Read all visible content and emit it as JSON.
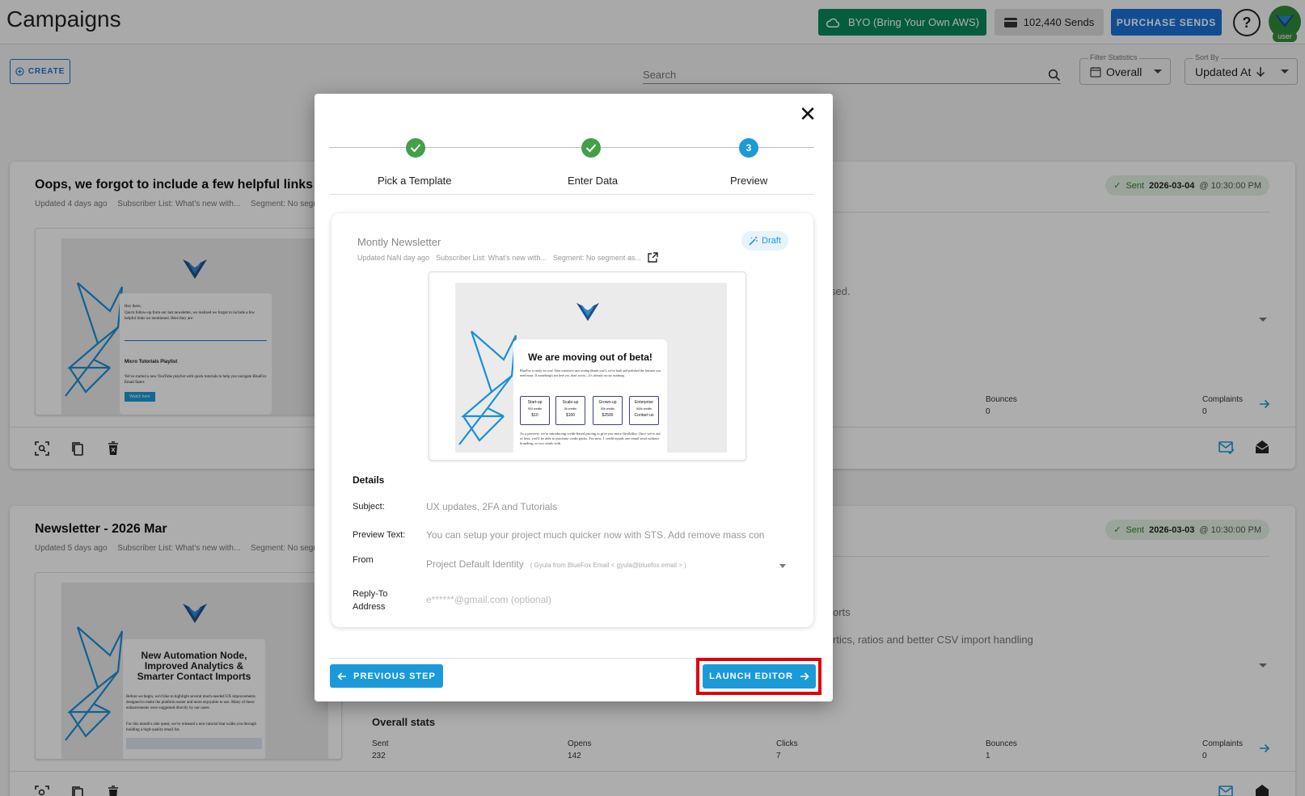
{
  "header": {
    "title": "Campaigns",
    "byo_label": "BYO (Bring Your Own AWS)",
    "sends_label": "102,440 Sends",
    "purchase_label": "PURCHASE SENDS",
    "help_label": "?",
    "avatar_badge": "user"
  },
  "toolbar": {
    "create_label": "CREATE",
    "search_placeholder": "Search",
    "filter": {
      "label": "Filter Statistics",
      "value": "Overall"
    },
    "sort": {
      "label": "Sort By",
      "value": "Updated At"
    }
  },
  "campaigns": [
    {
      "title": "Oops, we forgot to include a few helpful links",
      "updated": "Updated 4 days ago",
      "subscriber_list": "Subscriber List: What's new with...",
      "segment": "Segment: No segm",
      "status": "Sent",
      "date": "2026-03-04",
      "time": "@ 10:30:00 PM",
      "body_snippet": "sed.",
      "thumb_greeting": "Hey there,",
      "thumb_text": "Quick follow-up from our last newsletter, we realized we forgot to include a few helpful links we mentioned. Here they are:",
      "thumb_heading": "Micro Tutorials Playlist",
      "thumb_text2": "We've started a new YouTube playlist with quick tutorials to help you navigate BlueFox Email faster.",
      "thumb_button": "Watch here",
      "stats": {
        "bounces_label": "Bounces",
        "bounces": "0",
        "complaints_label": "Complaints",
        "complaints": "0"
      }
    },
    {
      "title": "Newsletter - 2026 Mar",
      "updated": "Updated 5 days ago",
      "subscriber_list": "Subscriber List: What's new with...",
      "segment": "Segment: No segm",
      "status": "Sent",
      "date": "2026-03-03",
      "time": "@ 10:30:00 PM",
      "body_snippet": "orts",
      "body_snippet2": "rtics, ratios and better CSV import handling",
      "thumb_heading": "New Automation Node, Improved Analytics & Smarter Contact Imports",
      "thumb_text": "Before we begin, we'd like to highlight several much-needed UX improvements designed to make the platform easier and more enjoyable to use. Many of these enhancements were suggested directly by our users.",
      "thumb_text2": "For this month's side quest, we've released a new tutorial that walks you through building a high-quality email list.",
      "overall_title": "Overall stats",
      "stats": {
        "sent_label": "Sent",
        "sent": "232",
        "opens_label": "Opens",
        "opens": "142",
        "clicks_label": "Clicks",
        "clicks": "7",
        "bounces_label": "Bounces",
        "bounces": "1",
        "complaints_label": "Complaints",
        "complaints": "0"
      }
    }
  ],
  "modal": {
    "close_label": "✕",
    "steps": [
      {
        "label": "Pick a Template",
        "state": "done"
      },
      {
        "label": "Enter Data",
        "state": "done"
      },
      {
        "label": "Preview",
        "state": "active",
        "number": "3"
      }
    ],
    "preview": {
      "title": "Montly Newsletter",
      "updated": "Updated NaN day ago",
      "subscriber_list": "Subscriber List: What's new with...",
      "segment": "Segment: No segment as...",
      "badge": "Draft",
      "email_headline": "We are moving out of beta!",
      "email_text": "BlueFox is ready for you! After extensive user testing (thank you!), we've built and polished the features you need most. If something's not here yet, don't worry—it's already on our roadmap.",
      "plans": [
        {
          "name": "Start-up",
          "sub": "500 credits",
          "price": "$10"
        },
        {
          "name": "Scale-up",
          "sub": "5k credits",
          "price": "$100"
        },
        {
          "name": "Grown-up",
          "sub": "50k credits",
          "price": "$2500"
        },
        {
          "name": "Enterprise",
          "sub": "500k credits",
          "price": "Contact us"
        }
      ],
      "email_text2": "As a preview, we're introducing credit-based pricing to give you more flexibility. Once we're out of beta, you'll be able to purchase credit packs. For now, 1 credit equals one email send without branding, or two sends with"
    },
    "details": {
      "title": "Details",
      "subject_label": "Subject:",
      "subject_value": "UX updates, 2FA and Tutorials",
      "preview_label": "Preview Text:",
      "preview_value": "You can setup your project much quicker now with STS. Add remove mass con",
      "from_label": "From",
      "from_value": "Project Default Identity",
      "from_hint": "( Gyula from BlueFox Email < gyula@bluefox.email > )",
      "reply_label": "Reply-To Address",
      "reply_value": "e******@gmail.com (optional)"
    },
    "prev_label": "PREVIOUS STEP",
    "launch_label": "LAUNCH EDITOR"
  },
  "colors": {
    "byo_green": "#0a8a5a",
    "primary_blue": "#1b72d9",
    "accent_blue": "#1b9ad9",
    "success_green": "#43a047",
    "highlight_red": "#e0000e"
  }
}
